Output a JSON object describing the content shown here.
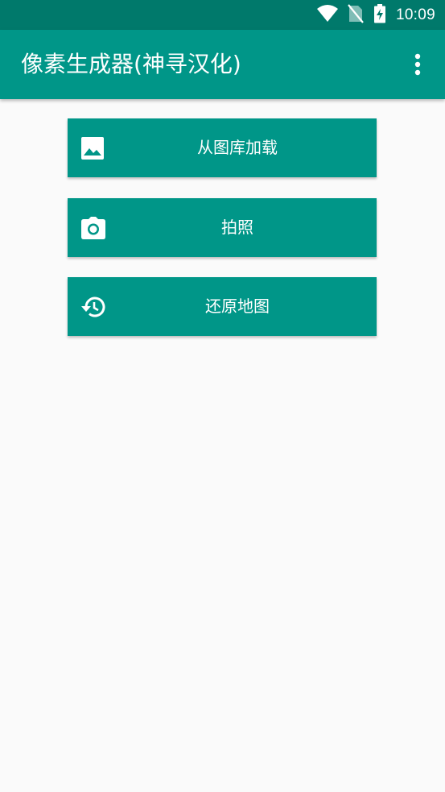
{
  "status_bar": {
    "time": "10:09",
    "icons": [
      "wifi-icon",
      "no-sim-icon",
      "battery-charging-icon"
    ]
  },
  "app_bar": {
    "title": "像素生成器(神寻汉化)",
    "menu_icon": "more-vert-icon"
  },
  "buttons": [
    {
      "label": "从图库加载",
      "icon": "image-icon"
    },
    {
      "label": "拍照",
      "icon": "camera-icon"
    },
    {
      "label": "还原地图",
      "icon": "history-icon"
    }
  ],
  "colors": {
    "status_bar": "#00796b",
    "primary": "#009688",
    "background": "#fafafa",
    "on_primary": "#ffffff"
  }
}
